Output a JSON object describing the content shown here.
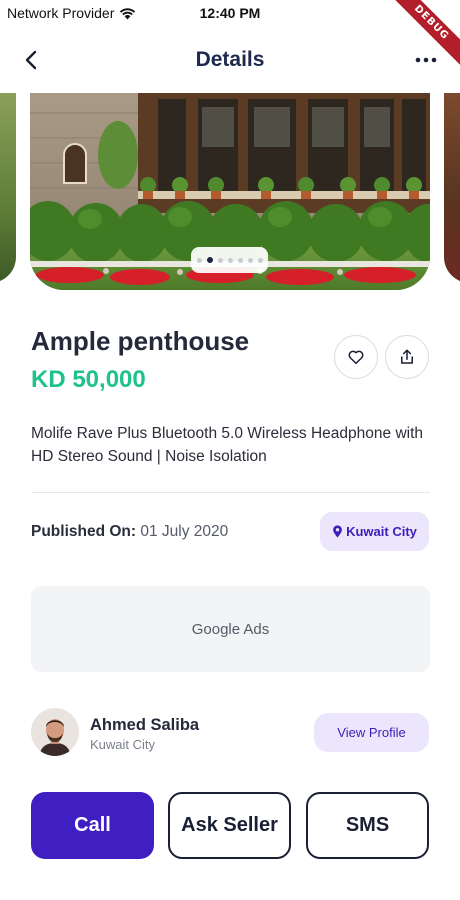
{
  "status_bar": {
    "carrier": "Network Provider",
    "time": "12:40 PM",
    "debug": "DEBUG"
  },
  "header": {
    "title": "Details",
    "back_icon": "chevron-left-icon",
    "more_icon": "more-horizontal-icon"
  },
  "carousel": {
    "dot_count": 7,
    "active_index": 1
  },
  "listing": {
    "title": "Ample penthouse",
    "price": "KD 50,000",
    "description": "Molife Rave Plus Bluetooth 5.0 Wireless Headphone with HD Stereo Sound | Noise Isolation",
    "published_label": "Published On:",
    "published_value": "01 July 2020",
    "location": "Kuwait City"
  },
  "ads": {
    "label": "Google Ads"
  },
  "seller": {
    "name": "Ahmed Saliba",
    "city": "Kuwait City",
    "view_profile": "View Profile"
  },
  "actions": {
    "call": "Call",
    "ask": "Ask Seller",
    "sms": "SMS"
  },
  "colors": {
    "primary": "#3f1fc2",
    "price": "#1ec28b",
    "chip_bg": "#ebe6fb",
    "title": "#1d2a4d"
  }
}
